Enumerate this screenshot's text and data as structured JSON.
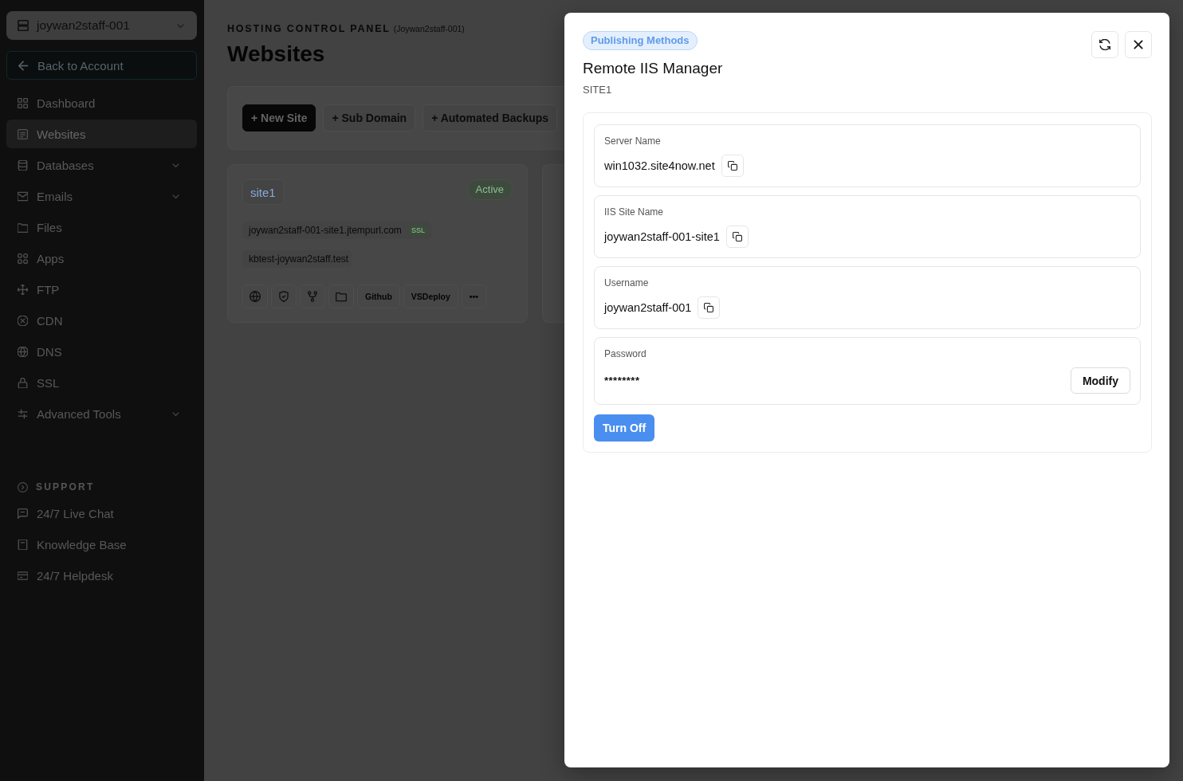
{
  "account_selector": {
    "label": "joywan2staff-001"
  },
  "sidebar": {
    "back_link": "Back to Account",
    "items": [
      {
        "label": "Dashboard",
        "selected": false,
        "has_submenu": false
      },
      {
        "label": "Websites",
        "selected": true,
        "has_submenu": false
      },
      {
        "label": "Databases",
        "selected": false,
        "has_submenu": true
      },
      {
        "label": "Emails",
        "selected": false,
        "has_submenu": true
      },
      {
        "label": "Files",
        "selected": false,
        "has_submenu": false
      },
      {
        "label": "Apps",
        "selected": false,
        "has_submenu": false
      },
      {
        "label": "FTP",
        "selected": false,
        "has_submenu": false
      },
      {
        "label": "CDN",
        "selected": false,
        "has_submenu": false
      },
      {
        "label": "DNS",
        "selected": false,
        "has_submenu": false
      },
      {
        "label": "SSL",
        "selected": false,
        "has_submenu": false
      },
      {
        "label": "Advanced Tools",
        "selected": false,
        "has_submenu": true
      }
    ],
    "support": {
      "title": "SUPPORT",
      "items": [
        {
          "label": "24/7 Live Chat"
        },
        {
          "label": "Knowledge Base"
        },
        {
          "label": "24/7 Helpdesk"
        }
      ]
    }
  },
  "page": {
    "eyebrow": "HOSTING CONTROL PANEL",
    "account_note": "(Joywan2staff-001)",
    "title": "Websites"
  },
  "toolbar": [
    {
      "label": "+ New Site",
      "primary": true
    },
    {
      "label": "+ Sub Domain",
      "primary": false
    },
    {
      "label": "+ Automated Backups",
      "primary": false
    }
  ],
  "site_cards": [
    {
      "name": "site1",
      "status": "Active",
      "domains": [
        {
          "host": "joywan2staff-001-site1.jtempurl.com",
          "ssl_badge": "SSL"
        },
        {
          "host": "kbtest-joywan2staff.test"
        }
      ],
      "text_actions": [
        "Github",
        "VSDeploy",
        "•••"
      ]
    }
  ],
  "modal": {
    "badge": "Publishing Methods",
    "title": "Remote IIS Manager",
    "subtitle": "SITE1",
    "fields": [
      {
        "kind": "copy",
        "label": "Server Name",
        "value": "win1032.site4now.net"
      },
      {
        "kind": "copy",
        "label": "IIS Site Name",
        "value": "joywan2staff-001-site1"
      },
      {
        "kind": "copy",
        "label": "Username",
        "value": "joywan2staff-001"
      },
      {
        "kind": "secret",
        "label": "Password",
        "value": "********",
        "action": "Modify"
      }
    ],
    "primary_action": "Turn Off"
  }
}
